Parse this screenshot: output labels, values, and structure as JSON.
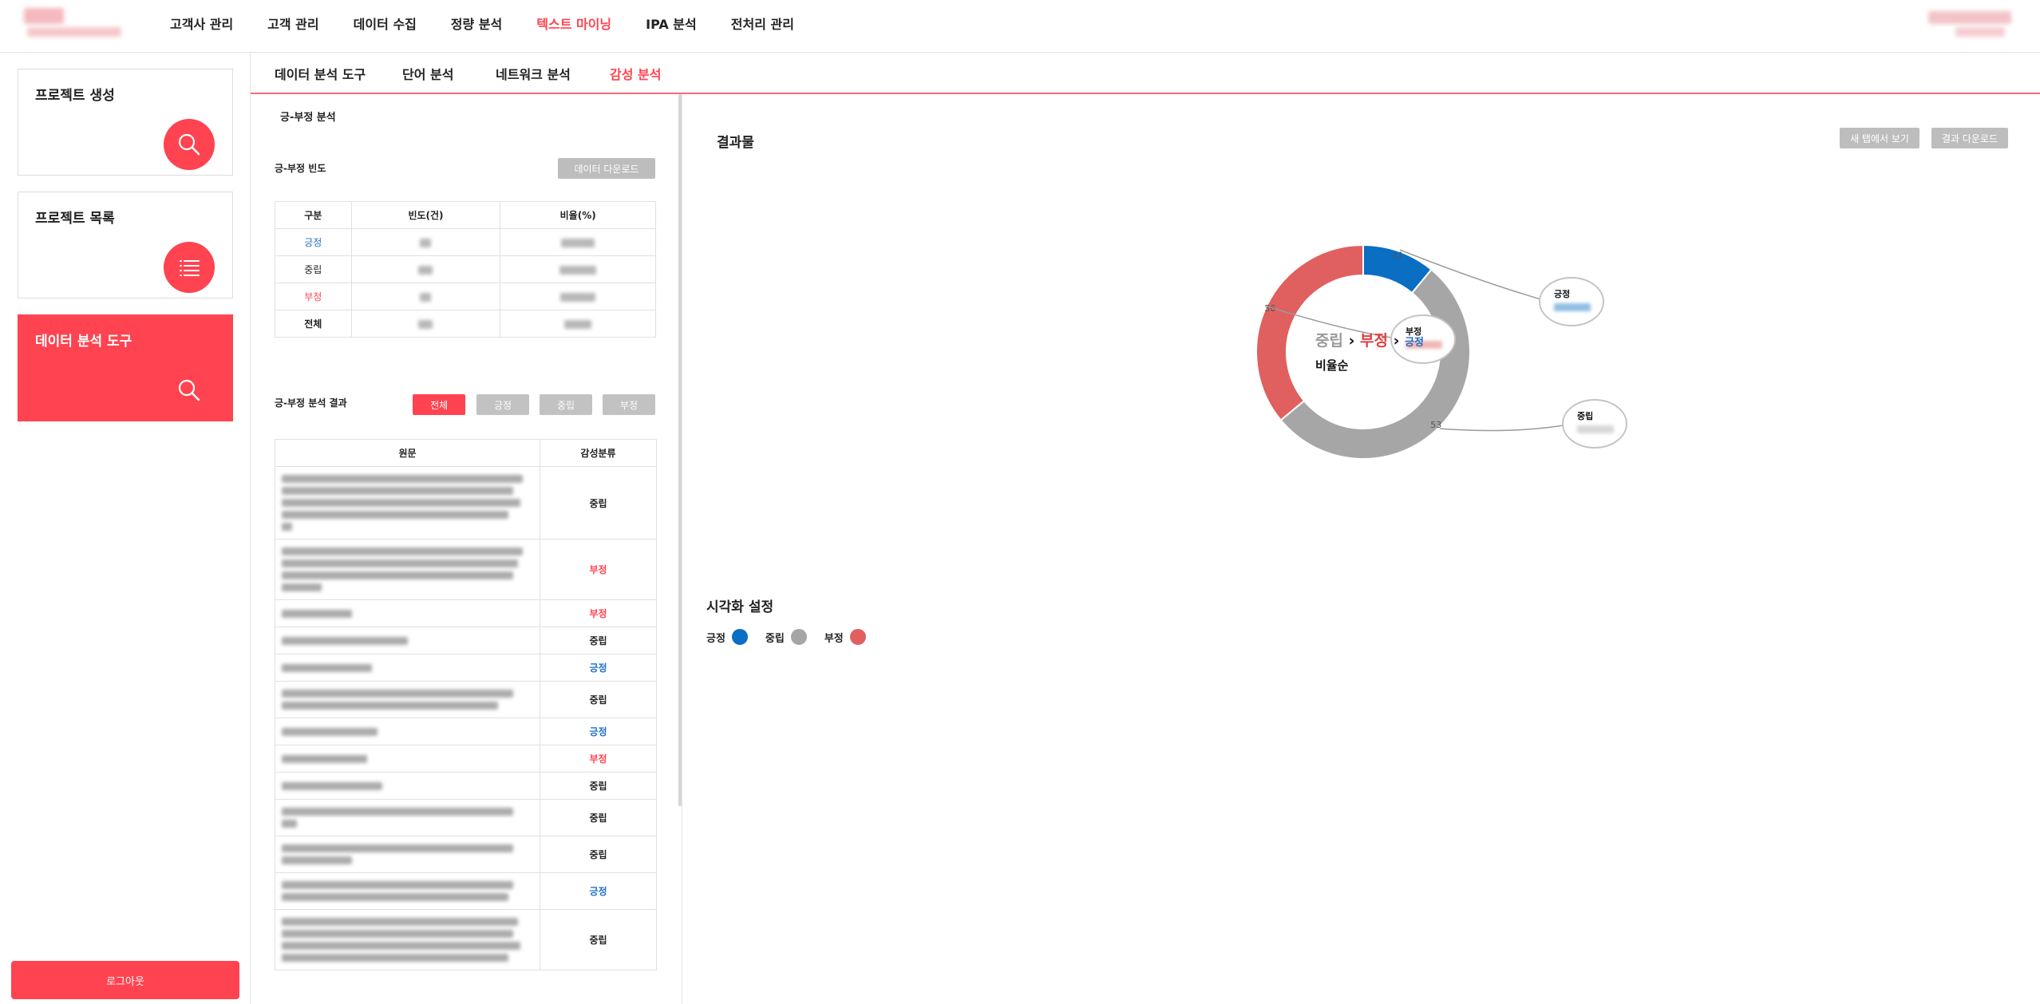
{
  "header": {
    "nav": [
      "고객사 관리",
      "고객 관리",
      "데이터 수집",
      "정량 분석",
      "텍스트 마이닝",
      "IPA 분석",
      "전처리 관리"
    ],
    "active_nav": "텍스트 마이닝"
  },
  "sidebar": {
    "items": [
      {
        "label": "프로젝트 생성",
        "icon": "search-icon"
      },
      {
        "label": "프로젝트 목록",
        "icon": "list-icon"
      },
      {
        "label": "데이터 분석 도구",
        "icon": "search-icon",
        "active": true
      }
    ],
    "logout": "로그아웃"
  },
  "subtabs": [
    "데이터 분석 도구",
    "단어 분석",
    "네트워크 분석",
    "감성 분석"
  ],
  "active_subtab": "감성 분석",
  "left": {
    "section_title": "긍-부정 분석",
    "freq_title": "긍-부정 빈도",
    "download_label": "데이터 다운로드",
    "freq_table": {
      "headers": [
        "구분",
        "빈도(건)",
        "비율(%)"
      ],
      "rows": [
        {
          "label": "긍정",
          "tone": "pos"
        },
        {
          "label": "중립",
          "tone": "neu"
        },
        {
          "label": "부정",
          "tone": "neg"
        },
        {
          "label": "전체",
          "tone": "neu"
        }
      ]
    },
    "result_title": "긍-부정 분석 결과",
    "filters": [
      "전체",
      "긍정",
      "중립",
      "부정"
    ],
    "active_filter": "전체",
    "result_table": {
      "headers": [
        "원문",
        "감성분류"
      ],
      "rows": [
        "중립",
        "부정",
        "부정",
        "중립",
        "긍정",
        "중립",
        "긍정",
        "부정",
        "중립",
        "중립",
        "중립",
        "긍정",
        "중립"
      ]
    }
  },
  "right": {
    "title": "결과물",
    "open_new_tab": "새 탭에서 보기",
    "download_result": "결과 다운로드",
    "viz_title": "시각화 설정",
    "legend": [
      {
        "label": "긍정",
        "color": "#0a6ec3"
      },
      {
        "label": "중립",
        "color": "#a6a6a6"
      },
      {
        "label": "부정",
        "color": "#e06060"
      }
    ]
  },
  "chart_data": {
    "type": "pie",
    "categories": [
      "긍정",
      "중립",
      "부정"
    ],
    "values": [
      11,
      53,
      36
    ],
    "colors": [
      "#0a6ec3",
      "#a6a6a6",
      "#e06060"
    ],
    "center_title": [
      "중립",
      "부정",
      "긍정"
    ],
    "center_subtitle": "비율순",
    "slice_labels": [
      "11",
      "53",
      "36"
    ]
  }
}
